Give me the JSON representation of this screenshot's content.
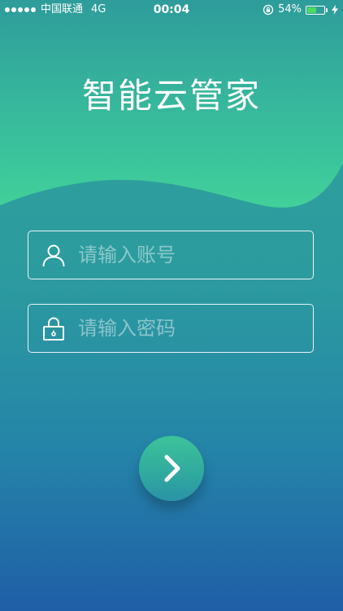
{
  "status_bar": {
    "carrier": "中国联通",
    "network": "4G",
    "time": "00:04",
    "battery_percent": "54%",
    "battery_level": 0.54,
    "battery_color": "#4cd964"
  },
  "app": {
    "title": "智能云管家"
  },
  "login": {
    "username_placeholder": "请输入账号",
    "username_value": "",
    "password_placeholder": "请输入密码",
    "password_value": "",
    "submit_icon": "chevron-right-icon"
  },
  "colors": {
    "wave": "#3fcf9a",
    "background_bottom": "#1f5fa7"
  }
}
